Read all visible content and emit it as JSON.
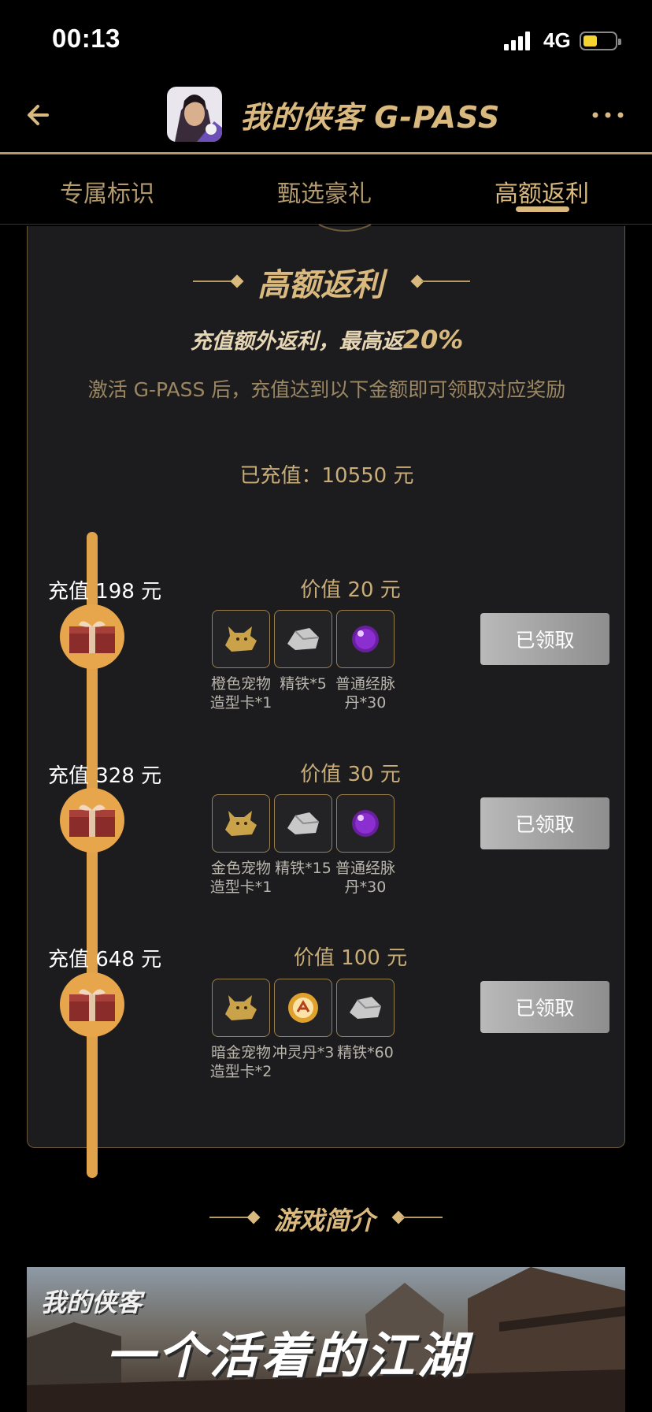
{
  "status_bar": {
    "time": "00:13",
    "network": "4G"
  },
  "header": {
    "title": "我的侠客 G-PASS"
  },
  "tabs": [
    {
      "label": "专属标识"
    },
    {
      "label": "甄选豪礼"
    },
    {
      "label": "高额返利",
      "active": true
    }
  ],
  "rebate": {
    "title": "高额返利",
    "subtitle_prefix": "充值额外返利，最高返",
    "subtitle_pct": "20%",
    "description": "激活 G-PASS 后，充值达到以下金额即可领取对应奖励",
    "recharged_label": "已充值：",
    "recharged_amount": "10550 元",
    "tiers": [
      {
        "label": "充值 198 元",
        "value": "价值 20 元",
        "button": "已领取",
        "items": [
          {
            "icon": "pet-card-icon",
            "name": "橙色宠物造型卡*1"
          },
          {
            "icon": "iron-ore-icon",
            "name": "精铁*5"
          },
          {
            "icon": "purple-pill-icon",
            "name": "普通经脉丹*30"
          }
        ]
      },
      {
        "label": "充值 328 元",
        "value": "价值 30 元",
        "button": "已领取",
        "items": [
          {
            "icon": "pet-card-icon",
            "name": "金色宠物造型卡*1"
          },
          {
            "icon": "iron-ore-icon",
            "name": "精铁*15"
          },
          {
            "icon": "purple-pill-icon",
            "name": "普通经脉丹*30"
          }
        ]
      },
      {
        "label": "充值 648 元",
        "value": "价值 100 元",
        "button": "已领取",
        "items": [
          {
            "icon": "pet-card-icon",
            "name": "暗金宠物造型卡*2"
          },
          {
            "icon": "spirit-pill-icon",
            "name": "冲灵丹*3"
          },
          {
            "icon": "iron-ore-icon",
            "name": "精铁*60"
          }
        ]
      }
    ]
  },
  "intro": {
    "title": "游戏简介",
    "banner_logo": "我的侠客",
    "banner_slogan": "一个活着的江湖"
  },
  "colors": {
    "gold": "#d9b97e",
    "card_bg": "#1c1c1e",
    "timeline": "#e0a24a"
  }
}
